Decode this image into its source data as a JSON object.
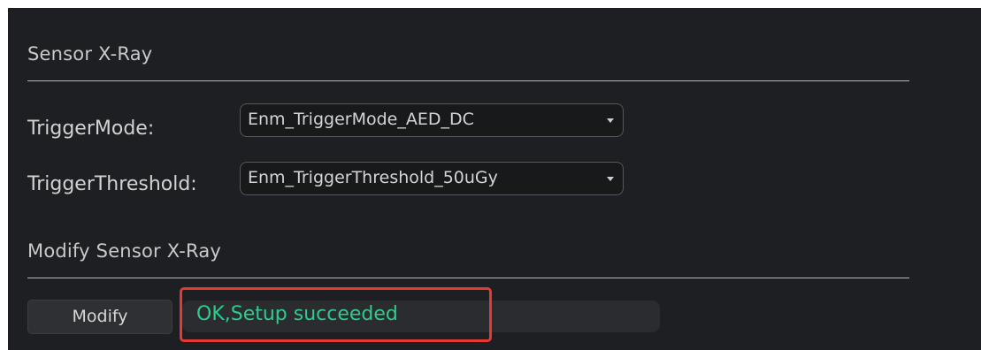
{
  "sections": {
    "sensor_xray": {
      "title": "Sensor X-Ray"
    },
    "modify": {
      "title": "Modify Sensor X-Ray"
    }
  },
  "fields": {
    "trigger_mode": {
      "label": "TriggerMode:",
      "value": "Enm_TriggerMode_AED_DC"
    },
    "trigger_threshold": {
      "label": "TriggerThreshold:",
      "value": "Enm_TriggerThreshold_50uGy"
    }
  },
  "actions": {
    "modify_label": "Modify"
  },
  "status": {
    "text": "OK,Setup succeeded"
  },
  "colors": {
    "background": "#1e1f22",
    "status_text": "#2ecb8d",
    "highlight_border": "#e53935"
  },
  "icons": {
    "dropdown": "chevron-down-icon"
  }
}
